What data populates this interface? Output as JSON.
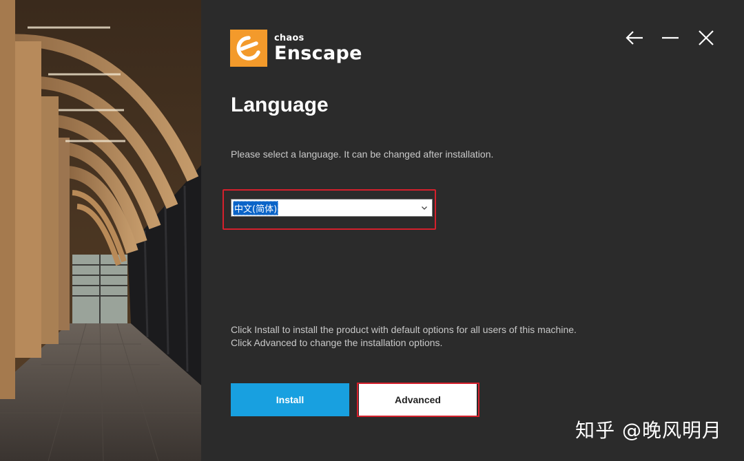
{
  "window": {
    "accent": "#f39a2b",
    "background": "#2b2b2b"
  },
  "hero": {
    "icon": "architectural-corridor-image"
  },
  "logo": {
    "brand": "chaos",
    "product": "Enscape",
    "icon": "enscape-logo-icon"
  },
  "controls": {
    "back_icon": "arrow-left-icon",
    "minimize_icon": "minimize-icon",
    "close_icon": "close-icon"
  },
  "page": {
    "title": "Language",
    "instruction": "Please select a language. It can be changed after installation."
  },
  "language_select": {
    "selected": "中文(简体)",
    "chevron_icon": "chevron-down-icon",
    "highlight_color": "#d6202c"
  },
  "info": {
    "line1": "Click Install to install the product with default options for all users of this machine.",
    "line2": "Click Advanced to change the installation options."
  },
  "buttons": {
    "install": "Install",
    "advanced": "Advanced",
    "install_color": "#18a0e0"
  },
  "watermark": {
    "text": "知乎 @晚风明月"
  }
}
